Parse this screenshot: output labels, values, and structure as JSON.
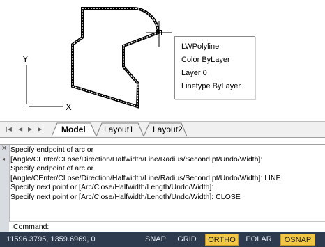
{
  "drawing": {
    "ucs_y_label": "Y",
    "ucs_x_label": "X",
    "tooltip": {
      "lines": [
        "LWPolyline",
        "Color  ByLayer",
        "Layer  0",
        "Linetype  ByLayer"
      ]
    }
  },
  "tabs": {
    "nav_first": "|◀",
    "nav_prev": "◀",
    "nav_next": "▶",
    "nav_last": "▶|",
    "items": [
      {
        "label": "Model",
        "active": true
      },
      {
        "label": "Layout1",
        "active": false
      },
      {
        "label": "Layout2",
        "active": false
      }
    ]
  },
  "command_window": {
    "history": [
      "Specify endpoint of arc or",
      "[Angle/CEnter/CLose/Direction/Halfwidth/Line/Radius/Second pt/Undo/Width]:",
      "Specify endpoint of arc or",
      "[Angle/CEnter/CLose/Direction/Halfwidth/Line/Radius/Second pt/Undo/Width]: LINE",
      "Specify next point or [Arc/Close/Halfwidth/Length/Undo/Width]:",
      "Specify next point or [Arc/Close/Halfwidth/Length/Undo/Width]: CLOSE"
    ],
    "prompt": "Command:",
    "input_value": ""
  },
  "status_bar": {
    "coordinates": "11596.3795, 1359.6969, 0",
    "buttons": [
      {
        "label": "SNAP",
        "on": false
      },
      {
        "label": "GRID",
        "on": false
      },
      {
        "label": "ORTHO",
        "on": true
      },
      {
        "label": "POLAR",
        "on": false
      },
      {
        "label": "OSNAP",
        "on": true
      }
    ]
  },
  "colors": {
    "statusbar_bg": "#2e3b4e",
    "toggle_on_bg": "#f2c744",
    "selected_polyline": "#000000"
  }
}
